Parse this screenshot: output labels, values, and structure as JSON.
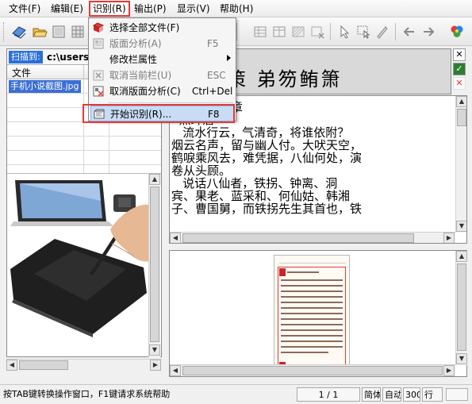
{
  "menubar": {
    "items": [
      {
        "label": "文件(F)"
      },
      {
        "label": "编辑(E)"
      },
      {
        "label": "识别(R)"
      },
      {
        "label": "输出(P)"
      },
      {
        "label": "显示(V)"
      },
      {
        "label": "帮助(H)"
      }
    ]
  },
  "recognize_menu": {
    "items": [
      {
        "label": "选择全部文件(F)",
        "shortcut": "",
        "disabled": false,
        "icon": "select-all-icon"
      },
      {
        "label": "版面分析(A)",
        "shortcut": "F5",
        "disabled": true,
        "icon": "layout-analysis-icon"
      },
      {
        "label": "修改栏属性",
        "shortcut": "",
        "disabled": false,
        "submenu": true
      },
      {
        "label": "取消当前栏(U)",
        "shortcut": "ESC",
        "disabled": true,
        "icon": "cancel-column-icon"
      },
      {
        "label": "取消版面分析(C)",
        "shortcut": "Ctrl+Del",
        "disabled": false,
        "icon": "cancel-layout-icon"
      },
      {
        "label": "开始识别(R)...",
        "shortcut": "F8",
        "disabled": false,
        "icon": "start-recognize-icon"
      }
    ]
  },
  "left_panel": {
    "scan_label": "扫描到:",
    "scan_path": "c:\\users",
    "file_column": "文件",
    "files": [
      "手机小说截图.jpg"
    ]
  },
  "char_strip": {
    "chars": "第策策 弟笏鲔箫"
  },
  "text_pane": {
    "highlight": "章",
    "text": "第一卷第一章\n  点绛唇\n   流水行云，气清奇，将谁依附？\n烟云名声，留与幽人付。大吠天空，\n鹤唳乘风去，难凭据，八仙何处，演\n卷从头顾。\n   说话八仙者，铁拐、钟离、洞\n宾、果老、蓝采和、何仙姑、韩湘\n子、曹国舅，而铁拐先生其首也，铁"
  },
  "status_bar": {
    "hint": "按TAB键转换操作窗口，F1键请求系统帮助",
    "page": "1 / 1",
    "mode1": "简体",
    "mode2": "自动",
    "dpi": "300",
    "row": "行"
  },
  "colors": {
    "highlight_border": "#e53935",
    "selection": "#3b6fd4",
    "scan_label_bg": "#2b6fd6"
  }
}
